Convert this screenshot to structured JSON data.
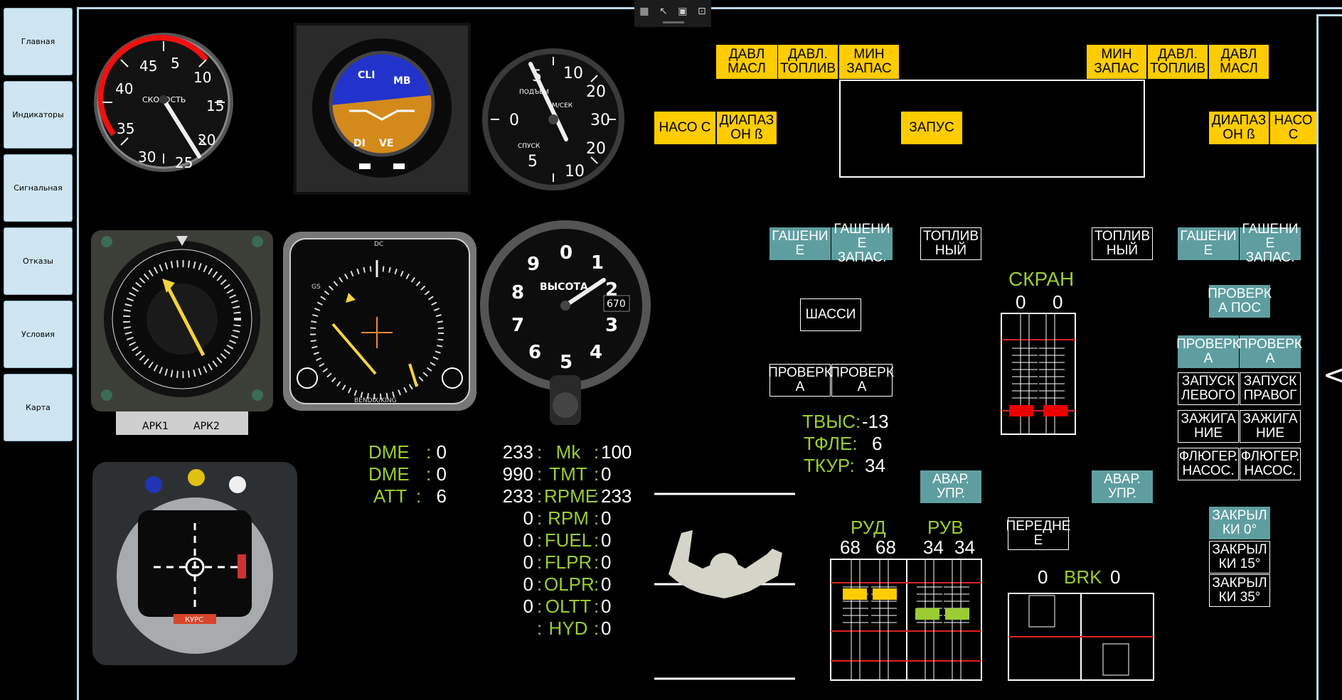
{
  "nav": [
    "Главная",
    "Индикаторы",
    "Сигнальная",
    "Отказы",
    "Условия",
    "Карта"
  ],
  "toolbar": {
    "icons": [
      "select-icon",
      "pointer-icon",
      "fit-icon",
      "zoom-icon"
    ]
  },
  "gauges": {
    "airspeed": {
      "label": "СКОРОСТЬ",
      "ticks": [
        "5",
        "10",
        "15",
        "20",
        "25",
        "30",
        "35",
        "40",
        "45"
      ]
    },
    "attitude": {
      "labels": [
        "CLI",
        "MB",
        "DI",
        "VE"
      ]
    },
    "vsi": {
      "label_up": "ПОДЪЕМ",
      "label_down": "СПУСК",
      "label_unit": "М/СЕК",
      "ticks": [
        "5",
        "10",
        "20",
        "30",
        "0",
        "20",
        "10",
        "5"
      ]
    },
    "adf": {
      "label1": "АРК1",
      "label2": "АРК2"
    },
    "hsi": {
      "brand": "BENDIX/KING",
      "top": "DC",
      "gs": "GS"
    },
    "altimeter": {
      "label": "ВЫСОТА",
      "readout": "670",
      "ticks": [
        "0",
        "1",
        "2",
        "3",
        "4",
        "5",
        "6",
        "7",
        "8",
        "9"
      ]
    },
    "ils": {
      "label": "КУРС"
    }
  },
  "readouts": {
    "dme1_label": "DME",
    "dme1_value": "0",
    "dme2_label": "DME",
    "dme2_value": "0",
    "att_label": "ATT",
    "att_value": "6",
    "rows": [
      {
        "l": "233",
        "n": "Mk",
        "r": "100"
      },
      {
        "l": "990",
        "n": "TMT",
        "r": "0"
      },
      {
        "l": "233",
        "n": "RPME",
        "r": "233"
      },
      {
        "l": "0",
        "n": "RPM",
        "r": "0"
      },
      {
        "l": "0",
        "n": "FUEL",
        "r": "0"
      },
      {
        "l": "0",
        "n": "FLPR",
        "r": "0"
      },
      {
        "l": "0",
        "n": "OLPR",
        "r": "0"
      },
      {
        "l": "0",
        "n": "OLTT",
        "r": "0"
      },
      {
        "l": "",
        "n": "HYD",
        "r": "0"
      }
    ]
  },
  "temps": {
    "tvys_label": "ТВЫС:",
    "tvys": "-13",
    "tfle_label": "ТФЛЕ:",
    "tfle": "6",
    "tkur_label": "ТКУР:",
    "tkur": "34"
  },
  "warn": {
    "davl_masl_l": "ДАВЛ МАСЛ",
    "davl_topl_l": "ДАВЛ. ТОПЛИВ",
    "min_zapas_l": "МИН ЗАПАС",
    "min_zapas_r": "МИН ЗАПАС",
    "davl_topl_r": "ДАВЛ. ТОПЛИВ",
    "davl_masl_r": "ДАВЛ МАСЛ",
    "nasos_l": "НАСО С",
    "diapazon_l": "ДИАПАЗ ОН ß",
    "zapusk": "ЗАПУС",
    "diapazon_r": "ДИАПАЗ ОН ß",
    "nasos_r": "НАСО С"
  },
  "buttons": {
    "gash_l1": "ГАШЕНИ Е",
    "gash_l2": "ГАШЕНИ Е ЗАПАС.",
    "topl_l": "ТОПЛИВ НЫЙ",
    "topl_r": "ТОПЛИВ НЫЙ",
    "gash_r1": "ГАШЕНИ Е",
    "gash_r2": "ГАШЕНИ Е ЗАПАС.",
    "shassi": "ШАССИ",
    "prov_l1": "ПРОВЕРК А",
    "prov_l2": "ПРОВЕРК А",
    "prov_pos": "ПРОВЕРК А ПОС",
    "prov_r1": "ПРОВЕРК А",
    "prov_r2": "ПРОВЕРК А",
    "zap_lev": "ЗАПУСК ЛЕВОГО",
    "zap_prav": "ЗАПУСК ПРАВОГ",
    "zazh_l": "ЗАЖИГА НИЕ",
    "zazh_r": "ЗАЖИГА НИЕ",
    "flug_l": "ФЛЮГЕР. НАСОС.",
    "flug_r": "ФЛЮГЕР. НАСОС.",
    "avar_l": "АВАР. УПР.",
    "avar_r": "АВАР. УПР.",
    "perednee": "ПЕРЕДНЕ Е",
    "zak0": "ЗАКРЫЛ КИ 0°",
    "zak15": "ЗАКРЫЛ КИ 15°",
    "zak35": "ЗАКРЫЛ КИ 35°"
  },
  "skran": {
    "title": "СКРАН",
    "v1": "0",
    "v2": "0"
  },
  "rud": {
    "title": "РУД",
    "v1": "68",
    "v2": "68"
  },
  "ruv": {
    "title": "РУВ",
    "v1": "34",
    "v2": "34"
  },
  "brk": {
    "title": "BRK",
    "v1": "0",
    "v2": "0"
  },
  "colors": {
    "yellow": "#ffcc00",
    "teal": "#5f9ea0",
    "green": "#9acd32",
    "frame": "#bcd7e8"
  }
}
